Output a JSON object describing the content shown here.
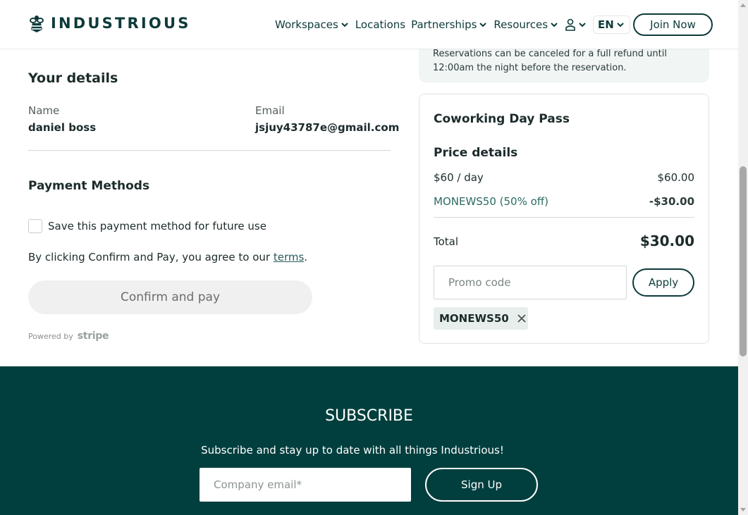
{
  "header": {
    "brand": "INDUSTRIOUS",
    "nav": [
      {
        "label": "Workspaces",
        "dropdown": true
      },
      {
        "label": "Locations",
        "dropdown": false
      },
      {
        "label": "Partnerships",
        "dropdown": true
      },
      {
        "label": "Resources",
        "dropdown": true
      }
    ],
    "language": "EN",
    "join_label": "Join Now"
  },
  "details": {
    "heading": "Your details",
    "name_label": "Name",
    "name_value": "daniel boss",
    "email_label": "Email",
    "email_value": "jsjuy43787e@gmail.com"
  },
  "payment": {
    "heading": "Payment Methods",
    "save_label": "Save this payment method for future use",
    "save_checked": false,
    "agree_prefix": "By clicking Confirm and Pay, you agree to our ",
    "agree_link": "terms",
    "agree_suffix": ".",
    "confirm_label": "Confirm and pay",
    "powered_by": "Powered by",
    "stripe": "stripe"
  },
  "reservation": {
    "cancel_policy": "Reservations can be canceled for a full refund until 12:00am the night before the reservation."
  },
  "summary": {
    "title": "Coworking Day Pass",
    "price_heading": "Price details",
    "line_label": "$60 / day",
    "line_amount": "$60.00",
    "discount_label": "MONEWS50 (50% off)",
    "discount_amount": "-$30.00",
    "total_label": "Total",
    "total_amount": "$30.00",
    "promo_placeholder": "Promo code",
    "apply_label": "Apply",
    "applied_code": "MONEWS50"
  },
  "footer": {
    "title": "SUBSCRIBE",
    "description": "Subscribe and stay up to date with all things Industrious!",
    "email_placeholder": "Company email*",
    "signup_label": "Sign Up"
  },
  "colors": {
    "brand_dark": "#0e3a3a",
    "footer_bg": "#003f3e",
    "discount_green": "#2c6b60"
  }
}
